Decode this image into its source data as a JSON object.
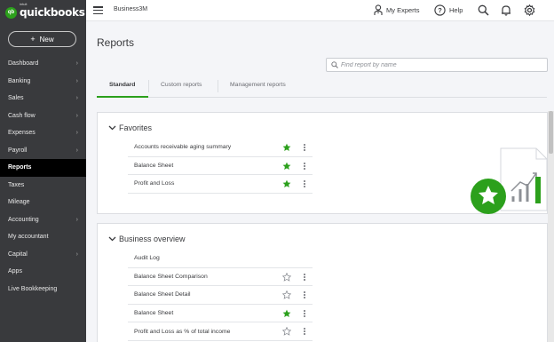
{
  "brand": {
    "intuit": "intuit",
    "name": "quickbooks",
    "mark": "qb"
  },
  "new_button": {
    "label": "New",
    "plus": "+"
  },
  "sidebar": {
    "items": [
      {
        "label": "Dashboard",
        "chevron": true,
        "active": false
      },
      {
        "label": "Banking",
        "chevron": true,
        "active": false
      },
      {
        "label": "Sales",
        "chevron": true,
        "active": false
      },
      {
        "label": "Cash flow",
        "chevron": true,
        "active": false
      },
      {
        "label": "Expenses",
        "chevron": true,
        "active": false
      },
      {
        "label": "Payroll",
        "chevron": true,
        "active": false
      },
      {
        "label": "Reports",
        "chevron": false,
        "active": true
      },
      {
        "label": "Taxes",
        "chevron": false,
        "active": false
      },
      {
        "label": "Mileage",
        "chevron": false,
        "active": false
      },
      {
        "label": "Accounting",
        "chevron": true,
        "active": false
      },
      {
        "label": "My accountant",
        "chevron": false,
        "active": false
      },
      {
        "label": "Capital",
        "chevron": true,
        "active": false
      },
      {
        "label": "Apps",
        "chevron": false,
        "active": false
      },
      {
        "label": "Live Bookkeeping",
        "chevron": false,
        "active": false
      }
    ],
    "chevron_glyph": "›"
  },
  "topbar": {
    "company": "Business3M",
    "my_experts": "My Experts",
    "help": "Help"
  },
  "page": {
    "title": "Reports",
    "search_placeholder": "Find report by name"
  },
  "tabs": [
    {
      "label": "Standard",
      "active": true
    },
    {
      "label": "Custom reports",
      "active": false
    },
    {
      "label": "Management reports",
      "active": false
    }
  ],
  "favorites": {
    "title": "Favorites",
    "reports": [
      {
        "name": "Accounts receivable aging summary",
        "favorited": true
      },
      {
        "name": "Balance Sheet",
        "favorited": true
      },
      {
        "name": "Profit and Loss",
        "favorited": true
      }
    ]
  },
  "business_overview": {
    "title": "Business overview",
    "reports": [
      {
        "name": "Audit Log",
        "favorited": null
      },
      {
        "name": "Balance Sheet Comparison",
        "favorited": false
      },
      {
        "name": "Balance Sheet Detail",
        "favorited": false
      },
      {
        "name": "Balance Sheet",
        "favorited": true
      },
      {
        "name": "Profit and Loss as % of total income",
        "favorited": false
      }
    ]
  },
  "colors": {
    "green": "#2ca01c",
    "sidebar": "#393a3d",
    "text": "#393a3d",
    "star_empty": "#8d9096"
  }
}
